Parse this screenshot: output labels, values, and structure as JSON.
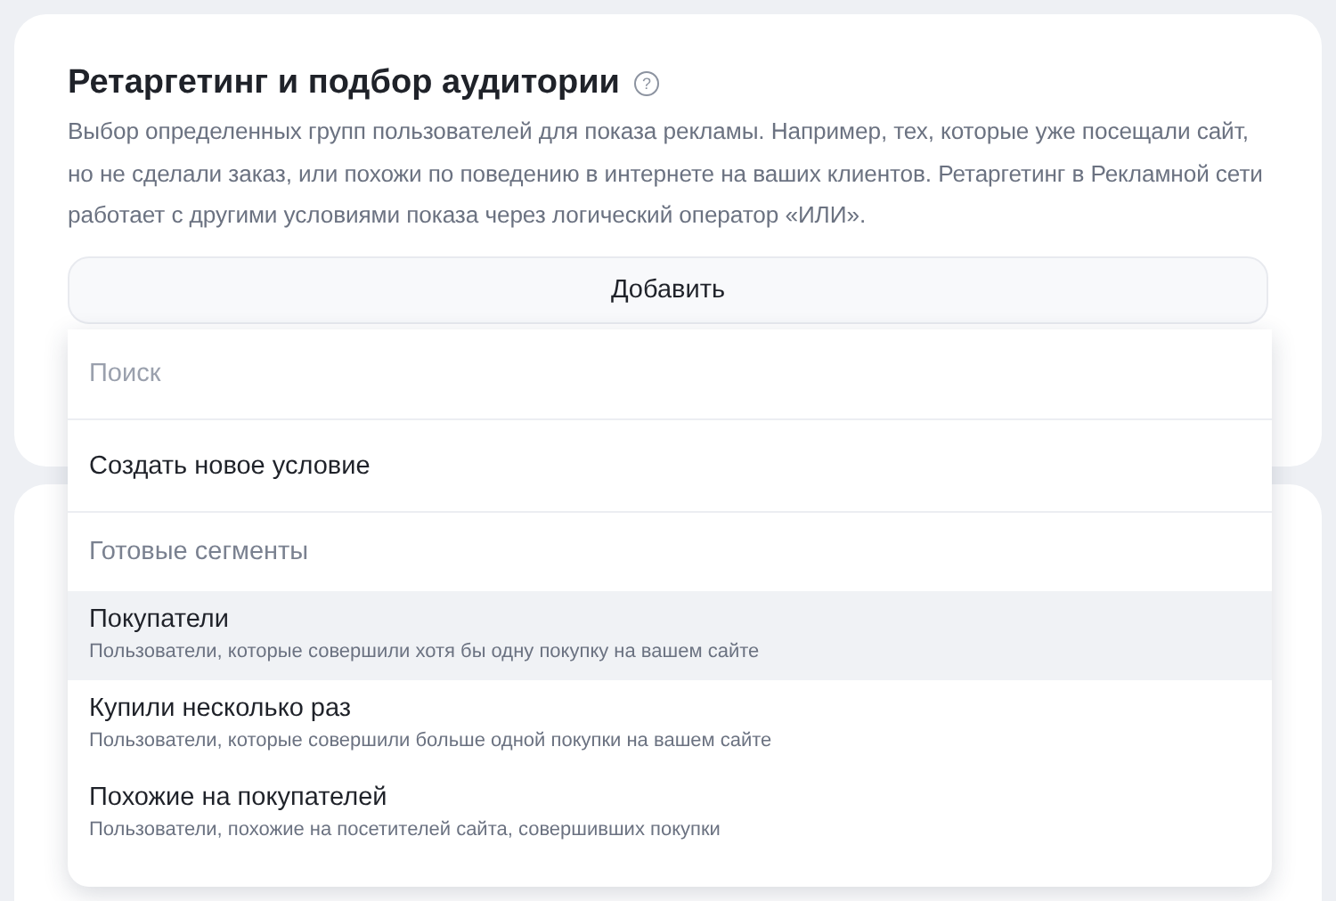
{
  "section": {
    "title": "Ретаргетинг и подбор аудитории",
    "help_icon": "?",
    "description": "Выбор определенных групп пользователей для показа рекламы. Например, тех, которые уже посещали сайт, но не сделали заказ, или похожи по поведению в интернете на ваших клиентов. Ретаргетинг в Рекламной сети работает с другими условиями показа через логический оператор «ИЛИ».",
    "add_button": "Добавить"
  },
  "dropdown": {
    "search": {
      "placeholder": "Поиск"
    },
    "items": [
      {
        "kind": "action",
        "label": "Создать новое условие"
      },
      {
        "kind": "header",
        "label": "Готовые сегменты"
      },
      {
        "kind": "option",
        "label": "Покупатели",
        "hint": "Пользователи, которые совершили хотя бы одну покупку на вашем сайте",
        "selected": true
      },
      {
        "kind": "option",
        "label": "Купили несколько раз",
        "hint": "Пользователи, которые совершили больше одной покупки на вашем сайте",
        "selected": false
      },
      {
        "kind": "option",
        "label": "Похожие на покупателей",
        "hint": "Пользователи, похожие на посетителей сайта, совершивших покупки",
        "selected": false
      }
    ]
  }
}
